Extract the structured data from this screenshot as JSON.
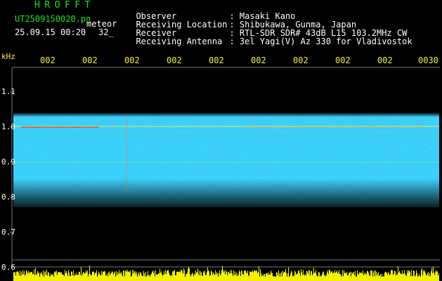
{
  "header": {
    "app_name": "HROFFT",
    "filename": "UT2509150020.pn",
    "type": "meteor",
    "datetime": "25.09.15 00:20",
    "count": "32_"
  },
  "info": [
    {
      "label": "Observer",
      "value": ": Masaki Kano"
    },
    {
      "label": "Receiving Location",
      "value": ": Shibukawa, Gunma, Japan"
    },
    {
      "label": "Receiver",
      "value": ": RTL-SDR SDR# 43dB L15 103.2MHz CW"
    },
    {
      "label": "Receiving Antenna",
      "value": ": 3el Yagi(V) Az 330 for Vladivostok"
    }
  ],
  "axis": {
    "y_unit": "kHz",
    "y_ticks": [
      "1.1",
      "1.0",
      "0.9",
      "0.8",
      "0.7",
      "0.6"
    ],
    "x_ticks": [
      "002",
      "002",
      "002",
      "002",
      "002",
      "002",
      "002",
      "002",
      "002",
      "0030"
    ]
  },
  "colors": {
    "grid": "#777777",
    "label_green": "#17e617",
    "label_yellow": "#f2f23a",
    "noise_band": "#1b35d6"
  }
}
